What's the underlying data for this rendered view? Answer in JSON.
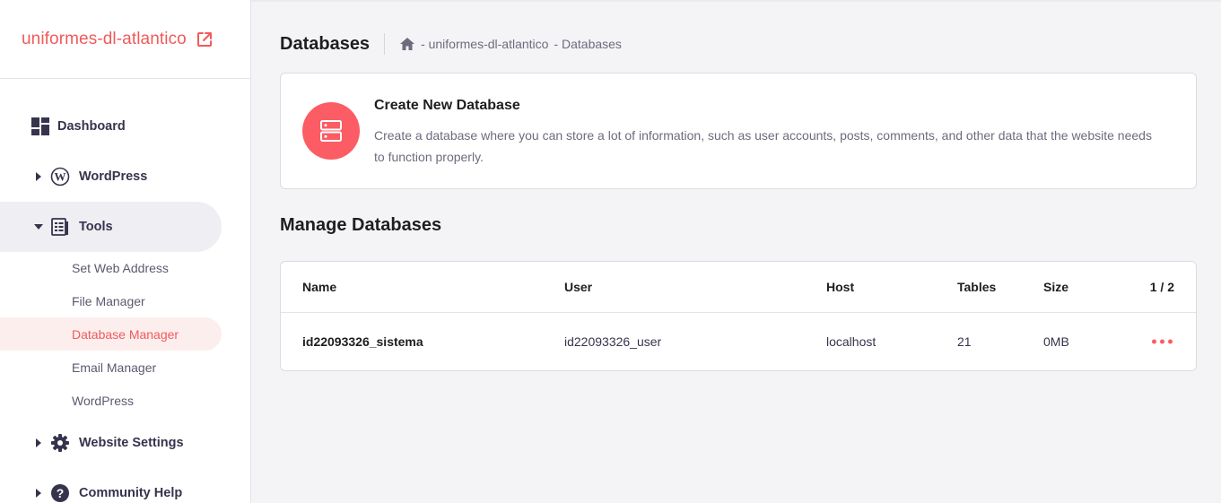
{
  "site": {
    "name": "uniformes-dl-atlantico"
  },
  "nav": {
    "dashboard": "Dashboard",
    "wordpress": "WordPress",
    "tools": "Tools",
    "tools_sub": [
      "Set Web Address",
      "File Manager",
      "Database Manager",
      "Email Manager",
      "WordPress"
    ],
    "website_settings": "Website Settings",
    "community_help": "Community Help"
  },
  "header": {
    "title": "Databases",
    "breadcrumb": [
      "- uniformes-dl-atlantico",
      "- Databases"
    ]
  },
  "create": {
    "title": "Create New Database",
    "description": "Create a database where you can store a lot of information, such as user accounts, posts, comments, and other data that the website needs to function properly."
  },
  "manage": {
    "title": "Manage Databases",
    "columns": {
      "name": "Name",
      "user": "User",
      "host": "Host",
      "tables": "Tables",
      "size": "Size",
      "count": "1 / 2"
    },
    "rows": [
      {
        "name": "id22093326_sistema",
        "user": "id22093326_user",
        "host": "localhost",
        "tables": "21",
        "size": "0MB"
      }
    ]
  },
  "colors": {
    "accent": "#fc5c63",
    "active_bg": "#fdeeee",
    "brand_text": "#f05a5a"
  }
}
